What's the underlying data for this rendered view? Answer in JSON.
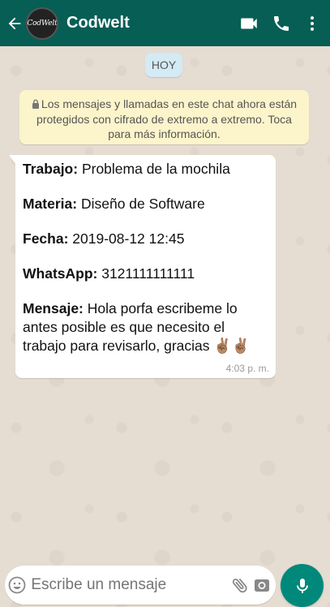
{
  "header": {
    "avatar_text": "CodWelt",
    "contact_name": "Codwelt"
  },
  "date_chip": "HOY",
  "notice": {
    "text": "Los mensajes y llamadas en este chat ahora están protegidos con cifrado de extremo a extremo. Toca para más información."
  },
  "message": {
    "fields": [
      {
        "label": "Trabajo:",
        "value": " Problema de la mochila"
      },
      {
        "label": "Materia:",
        "value": " Diseño de Software"
      },
      {
        "label": "Fecha:",
        "value": " 2019-08-12 12:45"
      },
      {
        "label": "WhatsApp:",
        "value": " 3121111111111"
      }
    ],
    "mensaje_label": "Mensaje:",
    "mensaje_text": " Hola porfa escribeme lo antes posible es que necesito el trabajo para revisarlo, gracias ",
    "emoji": "✌🏽✌🏽",
    "time": "4:03 p. m."
  },
  "composer": {
    "placeholder": "Escribe un mensaje"
  },
  "icons": {
    "back": "arrow-back-icon",
    "video": "video-camera-icon",
    "phone": "phone-icon",
    "menu": "more-vertical-icon",
    "lock": "lock-icon",
    "emoji": "emoji-icon",
    "attach": "paperclip-icon",
    "camera": "camera-icon",
    "mic": "microphone-icon"
  },
  "colors": {
    "header": "#075e54",
    "mic_button": "#00897b",
    "notice_bg": "#fcf4cb",
    "date_chip_bg": "#d4eaf4"
  }
}
